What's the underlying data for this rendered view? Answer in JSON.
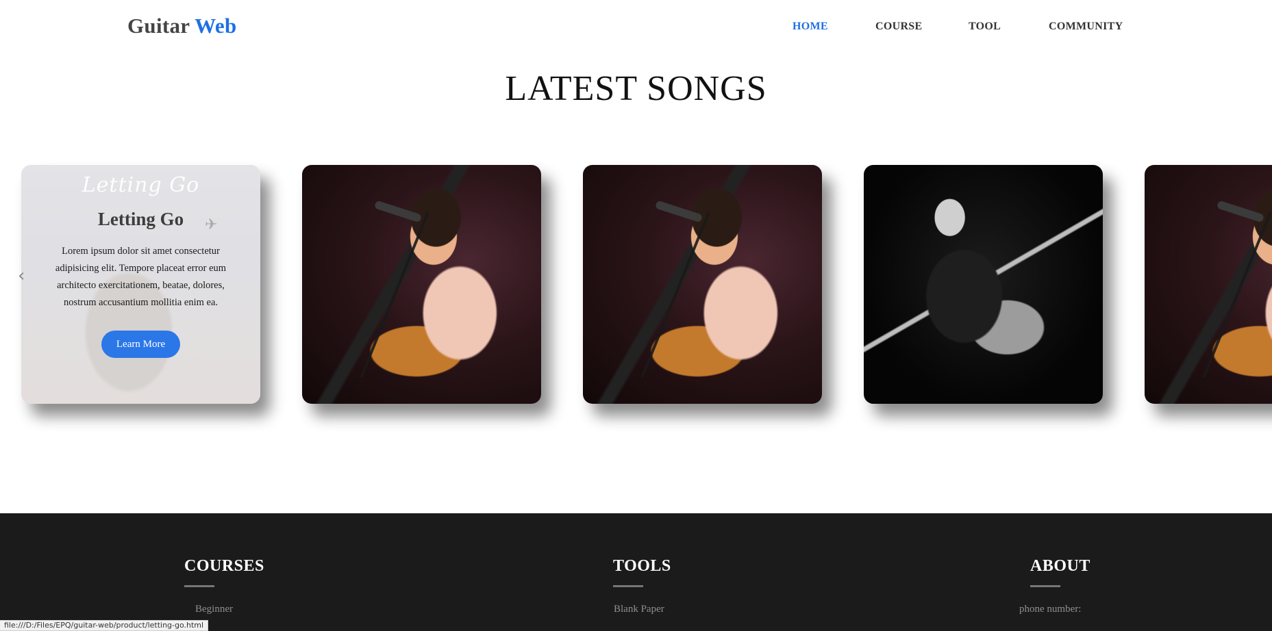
{
  "header": {
    "logo_main": "Guitar",
    "logo_accent": "Web",
    "nav": [
      {
        "label": "HOME",
        "active": true
      },
      {
        "label": "COURSE",
        "active": false
      },
      {
        "label": "TOOL",
        "active": false
      },
      {
        "label": "COMMUNITY",
        "active": false
      }
    ]
  },
  "section": {
    "title": "LATEST SONGS"
  },
  "featured_card": {
    "script_title": "Letting Go",
    "title": "Letting Go",
    "description": "Lorem ipsum dolor sit amet consectetur adipisicing elit. Tempore placeat error eum architecto exercitationem, beatae, dolores, nostrum accusantium mollitia enim ea.",
    "button_label": "Learn More"
  },
  "carousel": {
    "prev_icon": "chevron-left-icon",
    "cards": [
      {
        "image": "singer-with-guitar-color"
      },
      {
        "image": "singer-with-guitar-color"
      },
      {
        "image": "guitarist-black-and-white"
      },
      {
        "image": "singer-with-guitar-color"
      }
    ]
  },
  "footer": {
    "columns": [
      {
        "heading": "COURSES",
        "first_link": "Beginner"
      },
      {
        "heading": "TOOLS",
        "first_link": "Blank Paper"
      },
      {
        "heading": "ABOUT",
        "first_link": "phone number:"
      }
    ]
  },
  "status_bar": {
    "url": "file:///D:/Files/EPQ/guitar-web/product/letting-go.html"
  },
  "colors": {
    "accent": "#1f6fe5",
    "button": "#2b77e8",
    "footer_bg": "#1b1b1c"
  }
}
